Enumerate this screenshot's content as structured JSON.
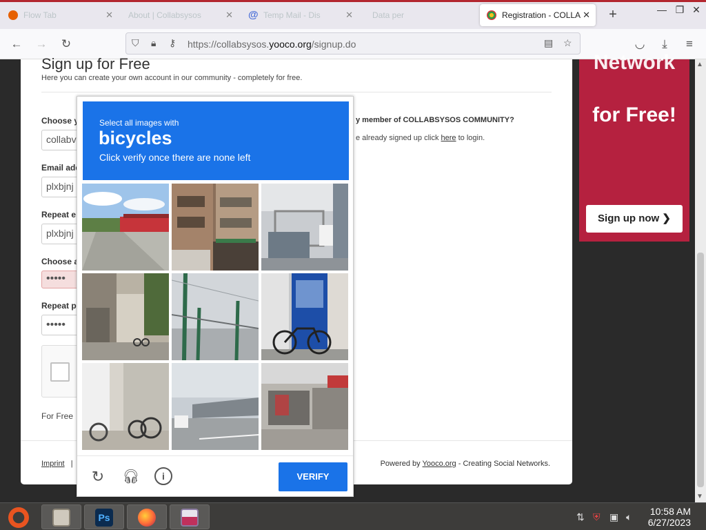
{
  "browser": {
    "tabs": [
      {
        "label": "Flow Tab",
        "active": false
      },
      {
        "label": "About | Collabsysos",
        "active": false
      },
      {
        "label": "Temp Mail - Dis",
        "active": false
      },
      {
        "label": "Data per",
        "active": false
      },
      {
        "label": "Registration - COLLA",
        "active": true
      }
    ],
    "url_prefix": "https://collabsysos.",
    "url_domain": "yooco.org",
    "url_path": "/signup.do"
  },
  "page": {
    "heading": "Sign up for Free",
    "intro": "Here you can create your own account in our community - completely for free.",
    "fields": [
      {
        "label": "Choose y",
        "value": "collabv"
      },
      {
        "label": "Email add",
        "value": "plxbjnj"
      },
      {
        "label": "Repeat e",
        "value": "plxbjnj"
      },
      {
        "label": "Choose a",
        "value": "•••••"
      },
      {
        "label": "Repeat p",
        "value": "•••••"
      }
    ],
    "free_text": "For Free",
    "member_question": "y member of COLLABSYSOS COMMUNITY?",
    "member_answer_pre": "e already signed up click ",
    "member_answer_link": "here",
    "member_answer_post": " to login.",
    "footer_imprint": "Imprint",
    "footer_sep": "|",
    "footer_sep2": "I",
    "footer_powered_pre": "Powered by ",
    "footer_powered_link": "Yooco.org",
    "footer_powered_post": " - Creating Social Networks."
  },
  "ad": {
    "top_text": "Network",
    "free_text": "for Free!",
    "button_label": "Sign up now",
    "button_arrow": "❯",
    "color": "#b5213f"
  },
  "captcha": {
    "instruction_line1": "Select all images with",
    "target": "bicycles",
    "instruction_line3": "Click verify once there are none left",
    "verify_label": "VERIFY",
    "icons": [
      "reload-icon",
      "headphones-icon",
      "info-icon"
    ],
    "header_color": "#1a73e8"
  },
  "taskbar": {
    "time": "10:58 AM",
    "date": "6/27/2023"
  }
}
